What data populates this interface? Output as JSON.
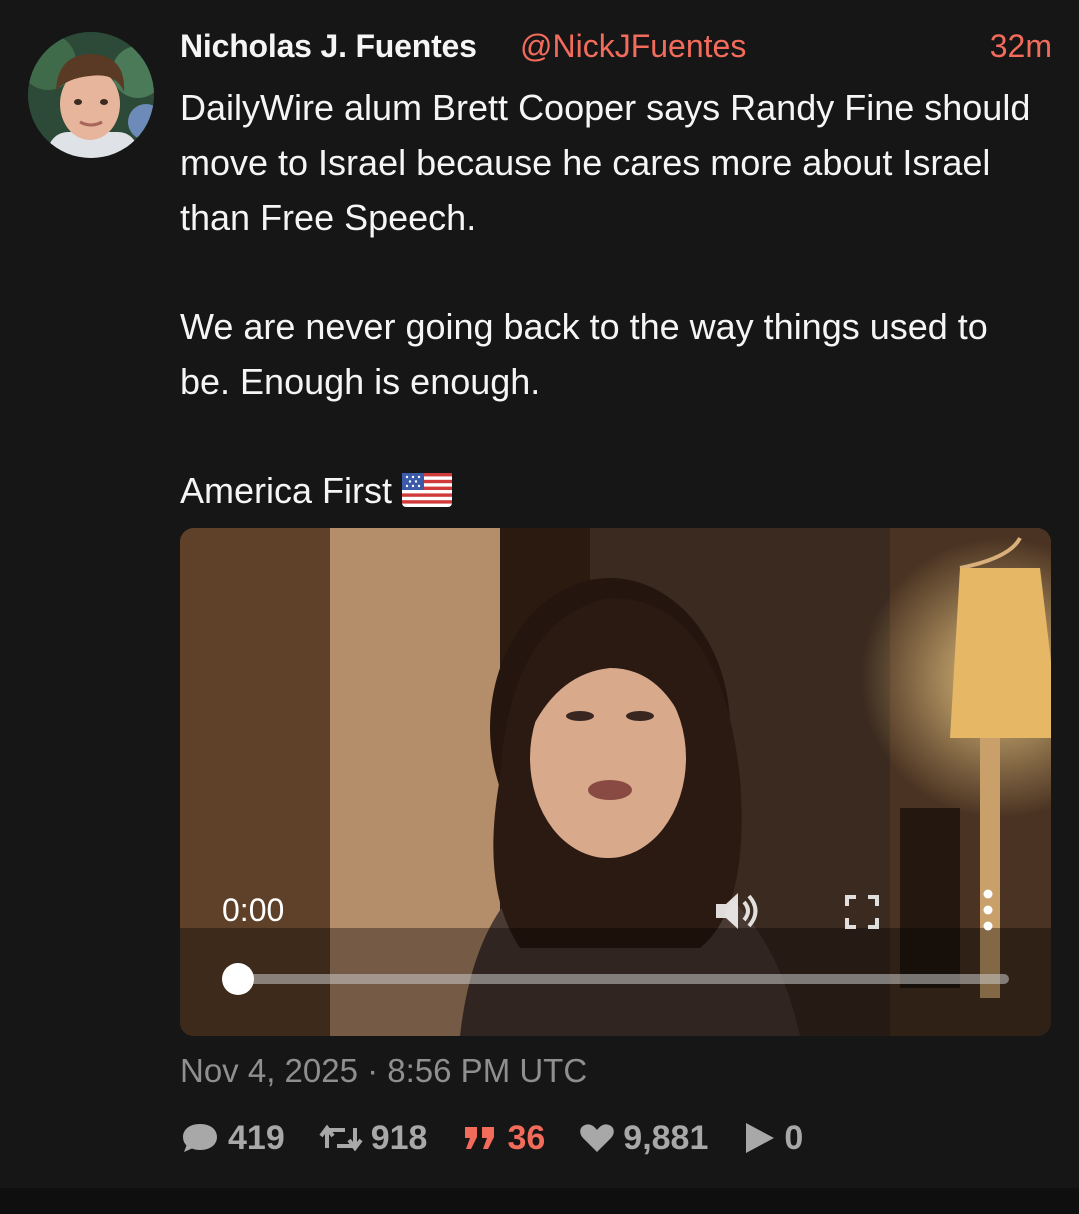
{
  "author": {
    "display_name": "Nicholas J. Fuentes",
    "handle": "@NickJFuentes"
  },
  "relative_time": "32m",
  "tweet": {
    "paragraphs": [
      "DailyWire alum Brett Cooper says Randy Fine should move to Israel because he cares more about Israel than Free Speech.",
      "We are never going back to the way things used to be. Enough is enough.",
      "America First"
    ],
    "flag_icon": "us-flag-icon"
  },
  "video": {
    "current_time": "0:00",
    "progress": 0,
    "icons": {
      "volume": "volume-icon",
      "fullscreen": "fullscreen-icon",
      "menu": "more-vertical-icon"
    }
  },
  "posted_at": "Nov 4, 2025 · 8:56 PM UTC",
  "stats": {
    "replies": "419",
    "retweets": "918",
    "quotes": "36",
    "likes": "9,881",
    "views": "0",
    "icons": {
      "replies": "comment-icon",
      "retweets": "retweet-icon",
      "quotes": "quote-icon",
      "likes": "heart-icon",
      "views": "play-icon"
    }
  },
  "colors": {
    "background": "#161616",
    "accent": "#f26b5b",
    "muted": "#8f8f8f",
    "stat": "#a8a8a8"
  }
}
